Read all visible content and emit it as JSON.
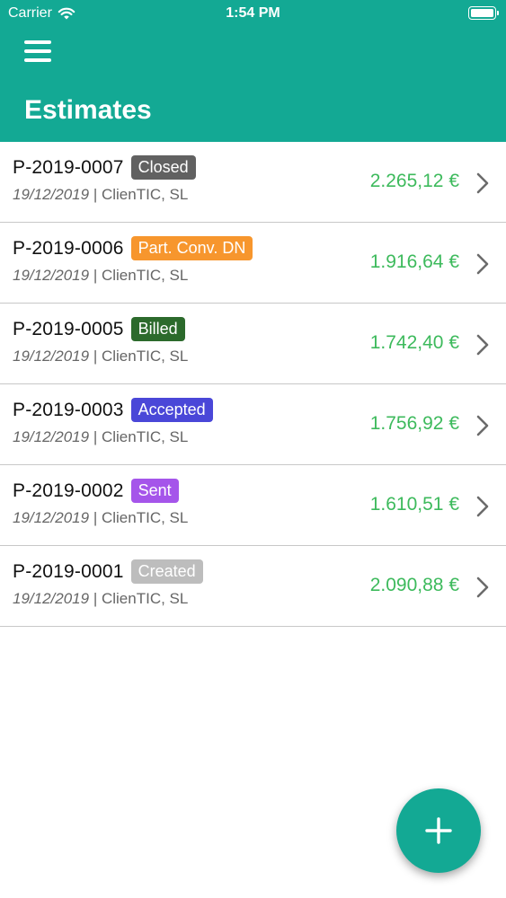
{
  "status_bar": {
    "carrier": "Carrier",
    "time": "1:54 PM"
  },
  "header": {
    "title": "Estimates"
  },
  "estimates": [
    {
      "number": "P-2019-0007",
      "status": "Closed",
      "status_color": "#616161",
      "date": "19/12/2019",
      "separator": " | ",
      "client": "ClienTIC, SL",
      "amount": "2.265,12 €"
    },
    {
      "number": "P-2019-0006",
      "status": "Part. Conv. DN",
      "status_color": "#f7962d",
      "date": "19/12/2019",
      "separator": " | ",
      "client": "ClienTIC, SL",
      "amount": "1.916,64 €"
    },
    {
      "number": "P-2019-0005",
      "status": "Billed",
      "status_color": "#2c6a2c",
      "date": "19/12/2019",
      "separator": " | ",
      "client": "ClienTIC, SL",
      "amount": "1.742,40 €"
    },
    {
      "number": "P-2019-0003",
      "status": "Accepted",
      "status_color": "#4a47d8",
      "date": "19/12/2019",
      "separator": " | ",
      "client": "ClienTIC, SL",
      "amount": "1.756,92 €"
    },
    {
      "number": "P-2019-0002",
      "status": "Sent",
      "status_color": "#a555ea",
      "date": "19/12/2019",
      "separator": " | ",
      "client": "ClienTIC, SL",
      "amount": "1.610,51 €"
    },
    {
      "number": "P-2019-0001",
      "status": "Created",
      "status_color": "#bdbdbd",
      "date": "19/12/2019",
      "separator": " | ",
      "client": "ClienTIC, SL",
      "amount": "2.090,88 €"
    }
  ],
  "colors": {
    "brand": "#13a994",
    "amount": "#3dba5c"
  },
  "icons": {
    "menu": "hamburger-icon",
    "row_arrow": "chevron-right-icon",
    "add": "plus-icon",
    "wifi": "wifi-icon",
    "battery": "battery-icon"
  }
}
